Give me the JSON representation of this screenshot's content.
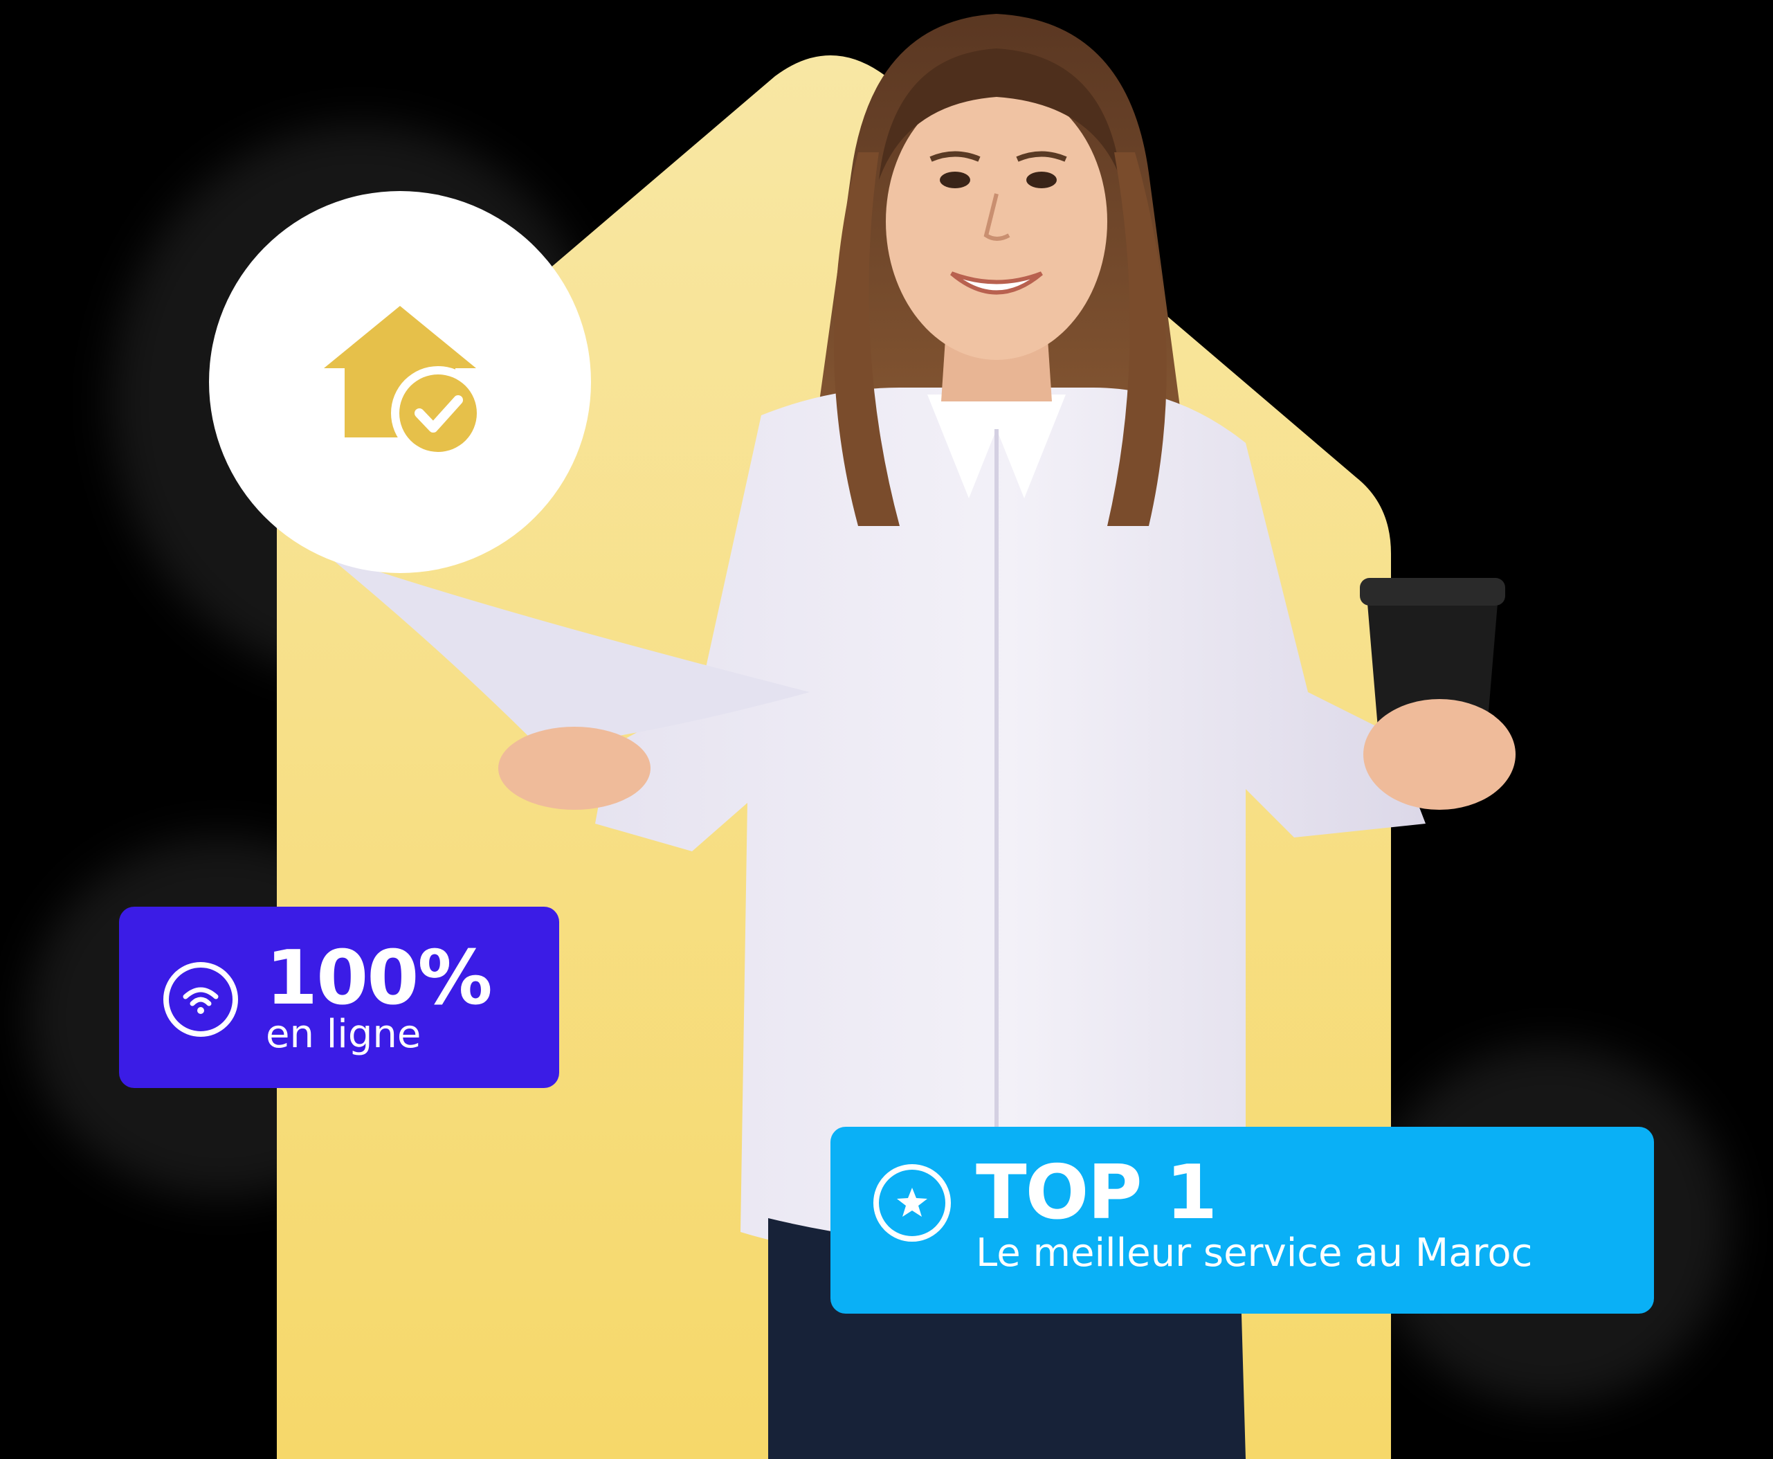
{
  "badges": {
    "online": {
      "title": "100%",
      "subtitle": "en ligne",
      "icon": "wifi-icon",
      "color": "#3b1ce6"
    },
    "top": {
      "title": "TOP 1",
      "subtitle": "Le meilleur service au Maroc",
      "icon": "star-icon",
      "color": "#0ab0f6"
    }
  },
  "home_badge": {
    "icon": "home-check-icon",
    "color": "#e6c04a"
  },
  "colors": {
    "background": "#000000",
    "yellow_shape": "#f7de7a",
    "white": "#ffffff"
  }
}
